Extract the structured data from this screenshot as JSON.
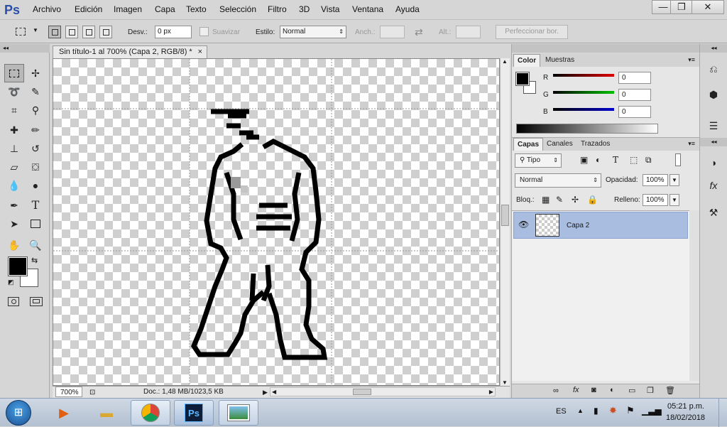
{
  "app": {
    "logo": "Ps"
  },
  "menu": [
    "Archivo",
    "Edición",
    "Imagen",
    "Capa",
    "Texto",
    "Selección",
    "Filtro",
    "3D",
    "Vista",
    "Ventana",
    "Ayuda"
  ],
  "window_controls": {
    "minimize": "—",
    "restore": "❐",
    "close": "✕"
  },
  "options": {
    "feather_label": "Desv.:",
    "feather_value": "0 px",
    "antialias_label": "Suavizar",
    "style_label": "Estilo:",
    "style_value": "Normal",
    "width_label": "Anch.:",
    "height_label": "Alt.:",
    "refine_button": "Perfeccionar bor."
  },
  "document": {
    "tab_title": "Sin título-1 al 700% (Capa 2, RGB/8) *",
    "zoom": "700%",
    "doc_info": "Doc.: 1,48 MB/1023,5 KB"
  },
  "color_panel": {
    "tabs": [
      "Color",
      "Muestras"
    ],
    "channels": [
      {
        "label": "R",
        "value": "0",
        "color": "#d10000"
      },
      {
        "label": "G",
        "value": "0",
        "color": "#00b000"
      },
      {
        "label": "B",
        "value": "0",
        "color": "#0000c8"
      }
    ]
  },
  "layers_panel": {
    "tabs": [
      "Capas",
      "Canales",
      "Trazados"
    ],
    "filter_kind": "Tipo",
    "blend_mode": "Normal",
    "opacity_label": "Opacidad:",
    "opacity_value": "100%",
    "lock_label": "Bloq.:",
    "fill_label": "Relleno:",
    "fill_value": "100%",
    "layers": [
      {
        "name": "Capa 2"
      }
    ]
  },
  "taskbar": {
    "language": "ES",
    "time": "05:21 p.m.",
    "date": "18/02/2018",
    "ps_label": "Ps"
  },
  "colors": {
    "foreground": "#000000",
    "background": "#ffffff",
    "selection_blue": "#a9bde0"
  }
}
